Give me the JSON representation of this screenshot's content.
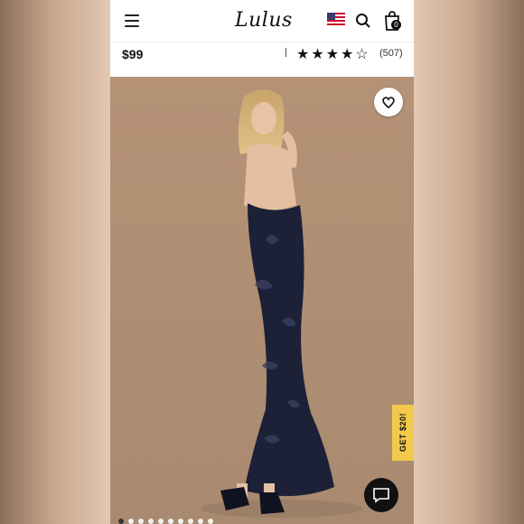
{
  "header": {
    "logo": "Lulus",
    "menu_icon": "hamburger-icon",
    "flag_icon": "us-flag-icon",
    "search_icon": "search-icon",
    "bag_icon": "shopping-bag-icon",
    "bag_count": "0"
  },
  "product": {
    "price": "$99",
    "stars": "★★★★☆",
    "rating": 4,
    "review_count": "(507)"
  },
  "hero": {
    "wishlist_icon": "heart-icon",
    "promo_label": "GET $20!",
    "chat_icon": "chat-icon",
    "carousel_count": 10,
    "carousel_active": 1
  },
  "colors": {
    "promo": "#f2c94c",
    "background": "#b8977d",
    "dress": "#1c2138"
  }
}
